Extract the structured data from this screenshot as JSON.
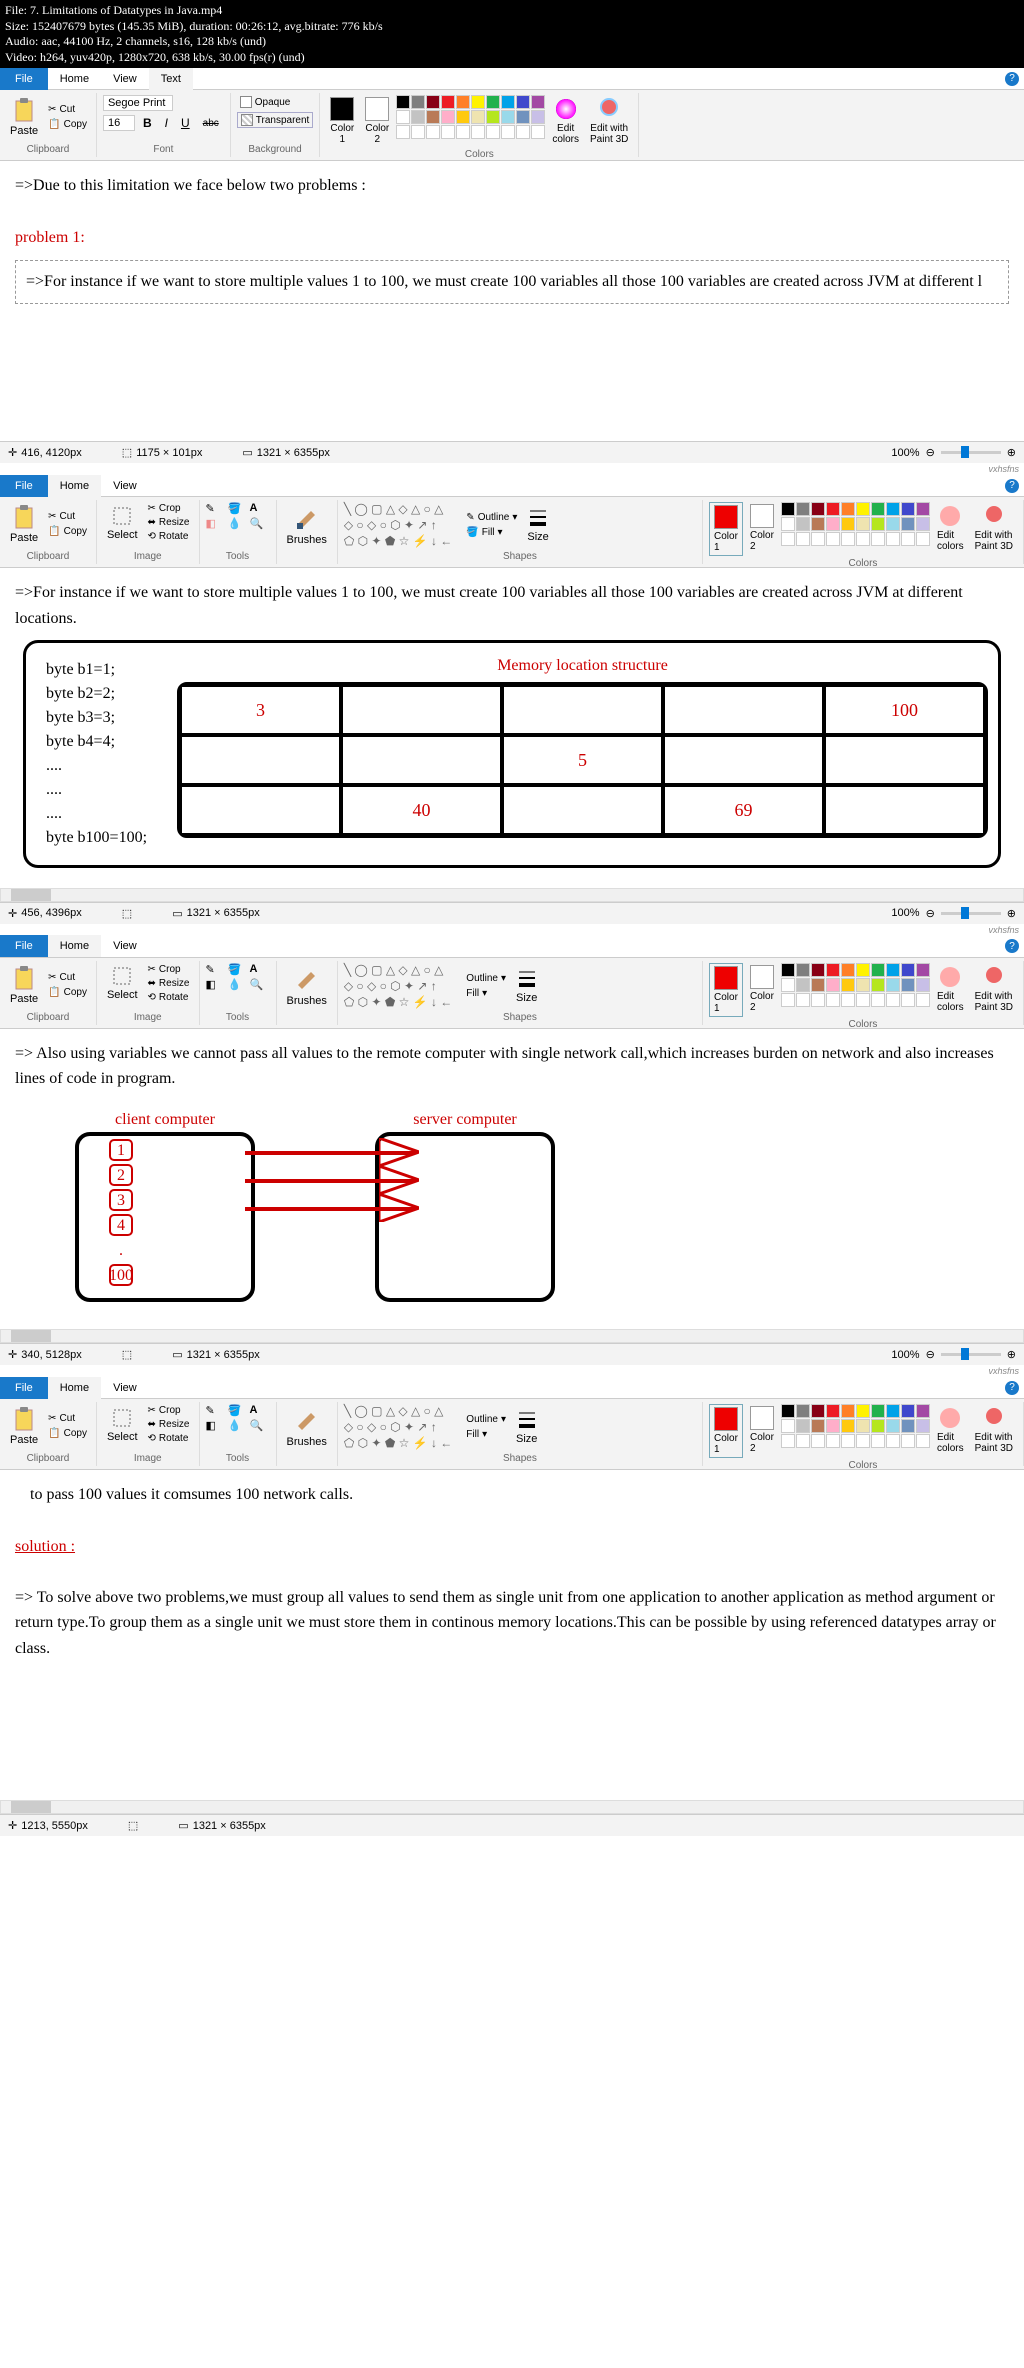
{
  "header": {
    "file": "File: 7. Limitations of Datatypes in Java.mp4",
    "size": "Size: 152407679 bytes (145.35 MiB), duration: 00:26:12, avg.bitrate: 776 kb/s",
    "audio": "Audio: aac, 44100 Hz, 2 channels, s16, 128 kb/s (und)",
    "video": "Video: h264, yuv420p, 1280x720, 638 kb/s, 30.00 fps(r) (und)"
  },
  "tabs": {
    "file": "File",
    "home": "Home",
    "view": "View",
    "text": "Text"
  },
  "ribbon": {
    "paste": "Paste",
    "cut": "Cut",
    "copy": "Copy",
    "clipboard": "Clipboard",
    "font": "Font",
    "fontName": "Segoe Print",
    "fontSize": "16",
    "bold": "B",
    "italic": "I",
    "underline": "U",
    "strike": "abc",
    "opaque": "Opaque",
    "transparent": "Transparent",
    "background": "Background",
    "color1": "Color\n1",
    "color2": "Color\n2",
    "colors": "Colors",
    "editColors": "Edit\ncolors",
    "editPaint3d": "Edit with\nPaint 3D",
    "select": "Select",
    "crop": "Crop",
    "resize": "Resize",
    "rotate": "Rotate",
    "image": "Image",
    "tools": "Tools",
    "brushes": "Brushes",
    "shapes": "Shapes",
    "outline": "Outline",
    "fill": "Fill",
    "size": "Size"
  },
  "canvas1": {
    "line1": "=>Due to this limitation we face below two problems :",
    "problem": "problem 1:",
    "boxed": "=>For instance if we want to store multiple values 1 to 100, we must create 100 variables all those 100 variables are created across JVM at different l"
  },
  "status1": {
    "pos": "416, 4120px",
    "sel": "1175 × 101px",
    "dim": "1321 × 6355px",
    "zoom": "100%"
  },
  "canvas2": {
    "text": "=>For instance if we want to store multiple values 1 to 100, we must create 100 variables all those 100 variables are created across JVM at different locations.",
    "memTitle": "Memory location structure",
    "code": [
      "byte b1=1;",
      "byte b2=2;",
      "byte b3=3;",
      "byte b4=4;",
      "....",
      "....",
      "....",
      "byte b100=100;"
    ],
    "cells": {
      "c3": "3",
      "c100": "100",
      "c5": "5",
      "c40": "40",
      "c69": "69"
    }
  },
  "status2": {
    "pos": "456, 4396px",
    "dim": "1321 × 6355px",
    "zoom": "100%"
  },
  "canvas3": {
    "text": "=> Also using variables we cannot pass all values to the remote computer with single network call,which increases burden on network and also increases lines of code in program.",
    "client": "client computer",
    "server": "server computer",
    "nums": [
      "1",
      "2",
      "3",
      "4",
      ".",
      "100"
    ]
  },
  "status3": {
    "pos": "340, 5128px",
    "dim": "1321 × 6355px",
    "zoom": "100%"
  },
  "canvas4": {
    "text1": "to pass 100 values it comsumes 100 network calls.",
    "solution": "solution :",
    "text2": "=> To solve above two problems,we must group all values to send them as single unit from one application to another application as method argument or return type.To group them as a single unit we must store them in continous memory locations.This can be possible by using referenced datatypes array or class."
  },
  "status4": {
    "pos": "1213, 5550px",
    "dim": "1321 × 6355px"
  },
  "watermark": "vxhsfns"
}
